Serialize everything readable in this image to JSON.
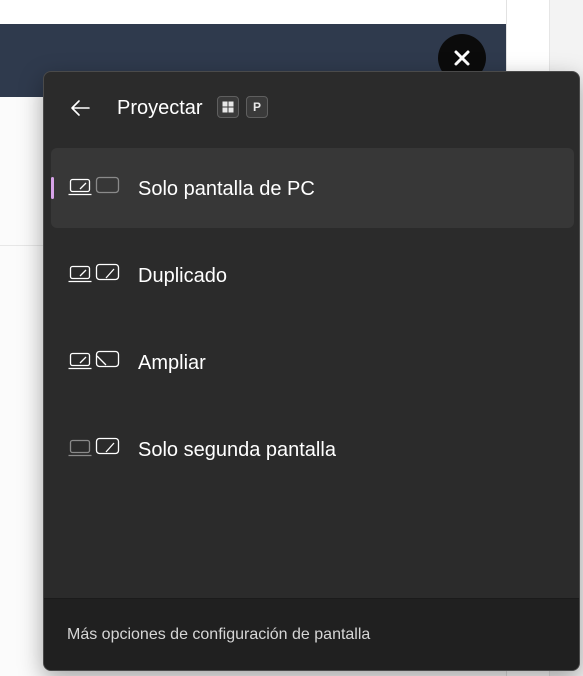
{
  "flyout": {
    "title": "Proyectar",
    "shortcut": {
      "key1": "win",
      "key2": "P"
    },
    "items": [
      {
        "label": "Solo pantalla de PC",
        "selected": true
      },
      {
        "label": "Duplicado",
        "selected": false
      },
      {
        "label": "Ampliar",
        "selected": false
      },
      {
        "label": "Solo segunda pantalla",
        "selected": false
      }
    ],
    "footer_link": "Más opciones de configuración de pantalla"
  },
  "colors": {
    "flyout_bg": "#2b2b2b",
    "selected_bg": "#373737",
    "accent_indicator": "#d7a3e8",
    "footer_bg": "#202020",
    "banner_bg": "#2f3a4d"
  },
  "icons": {
    "back": "arrow-left-icon",
    "close": "close-icon",
    "pc_only": "pc-screen-only-icon",
    "duplicate": "duplicate-icon",
    "extend": "extend-icon",
    "second_only": "second-screen-only-icon"
  }
}
